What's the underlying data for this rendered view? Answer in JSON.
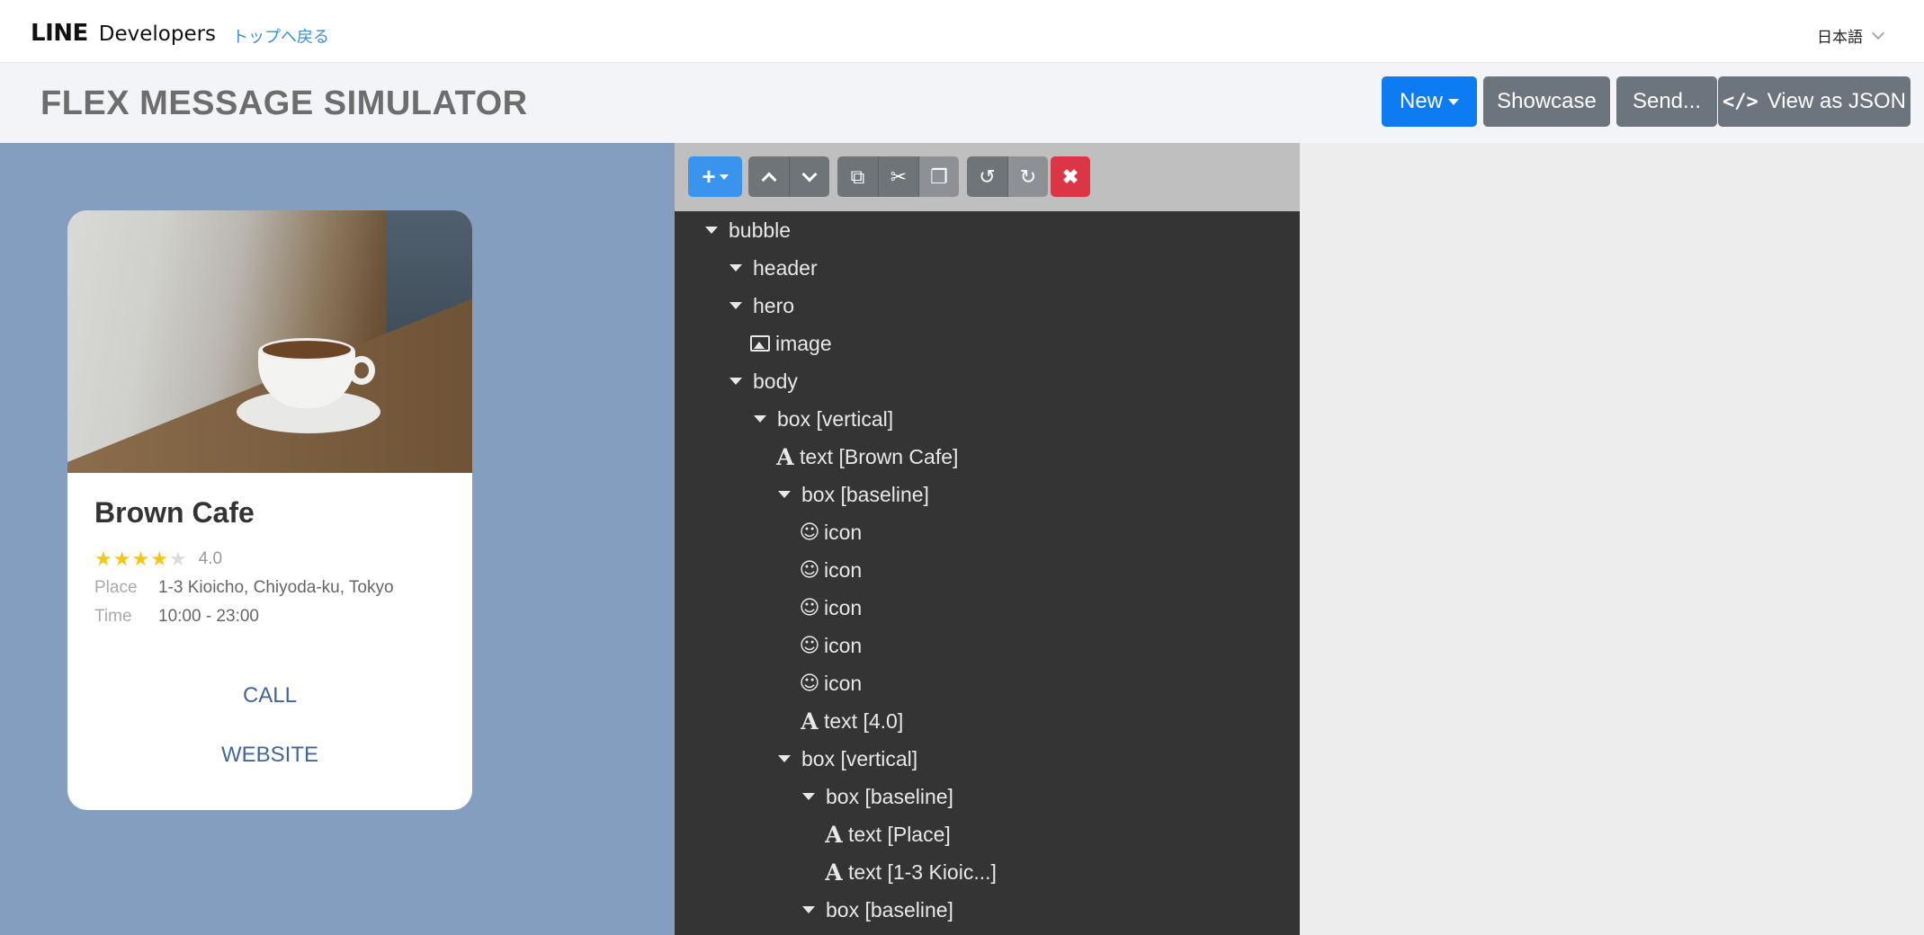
{
  "nav": {
    "brand_line": "LINE",
    "brand_dev": "Developers",
    "back_link": "トップへ戻る",
    "language": "日本語"
  },
  "header": {
    "title": "FLEX MESSAGE SIMULATOR",
    "buttons": {
      "new": "New",
      "showcase": "Showcase",
      "send": "Send...",
      "view_json": "View as JSON",
      "view_json_icon": "</>"
    }
  },
  "preview": {
    "name": "Brown Cafe",
    "rating_value": "4.0",
    "stars_filled": 4,
    "stars_total": 5,
    "place_label": "Place",
    "place_value": "1-3 Kioicho, Chiyoda-ku, Tokyo",
    "time_label": "Time",
    "time_value": "10:00 - 23:00",
    "call": "CALL",
    "website": "WEBSITE",
    "hero_image": "coffee-cup-photo"
  },
  "tree": [
    {
      "label": "bubble",
      "kind": "branch"
    },
    {
      "label": "header",
      "kind": "branch"
    },
    {
      "label": "hero",
      "kind": "branch"
    },
    {
      "label": "image",
      "kind": "image"
    },
    {
      "label": "body",
      "kind": "branch"
    },
    {
      "label": "box [vertical]",
      "kind": "branch"
    },
    {
      "label": "text [Brown Cafe]",
      "kind": "text"
    },
    {
      "label": "box [baseline]",
      "kind": "branch"
    },
    {
      "label": "icon",
      "kind": "icon"
    },
    {
      "label": "icon",
      "kind": "icon"
    },
    {
      "label": "icon",
      "kind": "icon"
    },
    {
      "label": "icon",
      "kind": "icon"
    },
    {
      "label": "icon",
      "kind": "icon"
    },
    {
      "label": "text [4.0]",
      "kind": "text"
    },
    {
      "label": "box [vertical]",
      "kind": "branch"
    },
    {
      "label": "box [baseline]",
      "kind": "branch"
    },
    {
      "label": "text [Place]",
      "kind": "text"
    },
    {
      "label": "text [1-3 Kioic...]",
      "kind": "text"
    },
    {
      "label": "box [baseline]",
      "kind": "branch"
    }
  ],
  "colors": {
    "primary": "#0d7cf2",
    "secondary": "#6c757d",
    "danger": "#dc3545",
    "preview_bg": "#849ebf",
    "tree_bg": "#343434",
    "link": "#42659a",
    "star": "#f5c518"
  }
}
